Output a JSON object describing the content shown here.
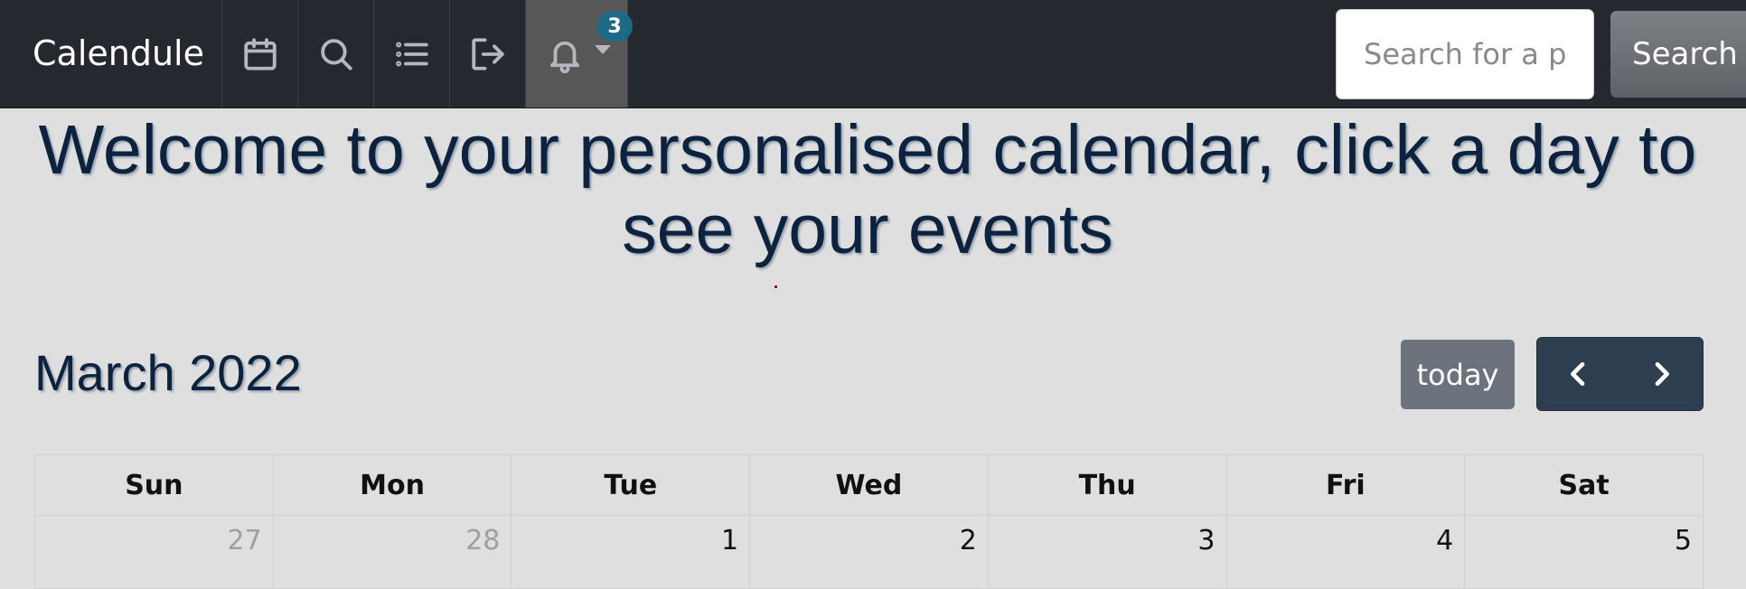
{
  "navbar": {
    "brand": "Calendule",
    "items": [
      {
        "icon": "calendar-icon"
      },
      {
        "icon": "search-icon"
      },
      {
        "icon": "list-icon"
      },
      {
        "icon": "logout-icon"
      },
      {
        "icon": "bell-icon"
      }
    ],
    "notification_count": "3",
    "search": {
      "placeholder": "Search for a person",
      "button_label": "Search"
    }
  },
  "heading": "Welcome to your personalised calendar, click a day to see your events",
  "calendar": {
    "month_title": "March 2022",
    "today_label": "today",
    "weekdays": [
      "Sun",
      "Mon",
      "Tue",
      "Wed",
      "Thu",
      "Fri",
      "Sat"
    ],
    "first_row": [
      "27",
      "28",
      "1",
      "2",
      "3",
      "4",
      "5"
    ]
  },
  "colors": {
    "navbar_bg": "#25282e",
    "page_bg": "#dfdfdf",
    "heading": "#0c2340",
    "badge": "#1d6a86",
    "nav_group": "#2c3e50",
    "today_button": "#6c737c"
  }
}
